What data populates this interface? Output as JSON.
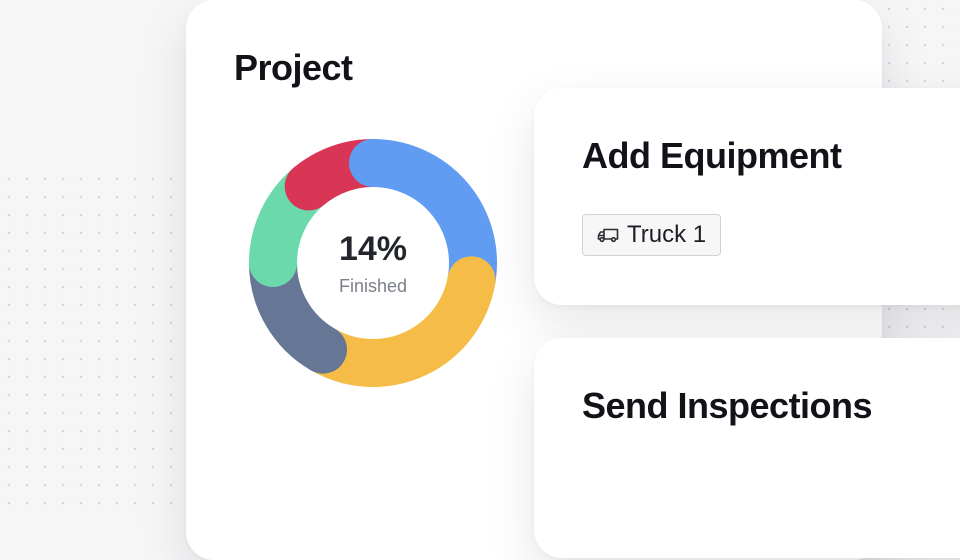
{
  "project_card": {
    "title": "Project",
    "progress": {
      "percent_label": "14%",
      "caption": "Finished",
      "segments": [
        {
          "color": "#619cf3",
          "start_deg": 0,
          "end_deg": 100
        },
        {
          "color": "#f5bd47",
          "start_deg": 100,
          "end_deg": 210
        },
        {
          "color": "#657794",
          "start_deg": 210,
          "end_deg": 270
        },
        {
          "color": "#6bd9ab",
          "start_deg": 270,
          "end_deg": 320
        },
        {
          "color": "#d93555",
          "start_deg": 320,
          "end_deg": 360
        }
      ]
    }
  },
  "equipment_card": {
    "title": "Add Equipment",
    "chip": {
      "icon": "truck-icon",
      "label": "Truck 1"
    }
  },
  "inspections_card": {
    "title": "Send Inspections"
  }
}
